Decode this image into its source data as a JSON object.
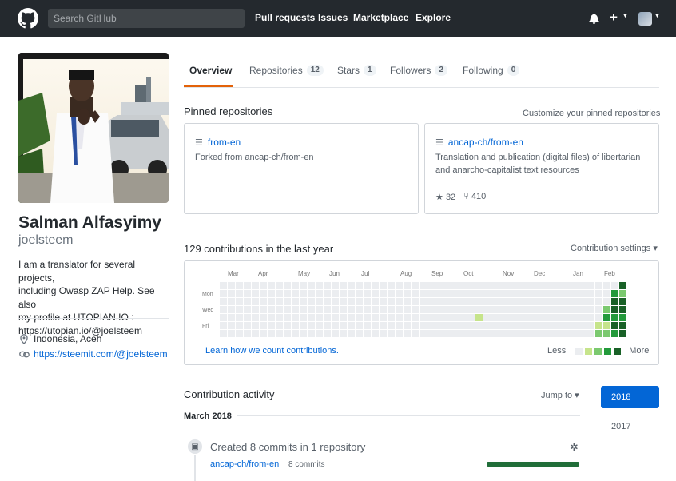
{
  "header": {
    "search_placeholder": "Search GitHub",
    "nav": [
      "Pull requests",
      "Issues",
      "Marketplace",
      "Explore"
    ],
    "icons": [
      "bell-icon",
      "plus-icon",
      "avatar-menu"
    ]
  },
  "profile": {
    "name": "Salman Alfasyimy",
    "login": "joelsteem",
    "bio_lines": [
      "I am a translator for several projects,",
      "including Owasp ZAP Help. See also",
      "my profile at UTOPIAN.IO :",
      "https://utopian.io/@joelsteem"
    ],
    "location": "Indonesia, Aceh",
    "website": "https://steemit.com/@joelsteem"
  },
  "tabs": [
    {
      "label": "Overview",
      "count": ""
    },
    {
      "label": "Repositories",
      "count": "12"
    },
    {
      "label": "Stars",
      "count": "1"
    },
    {
      "label": "Followers",
      "count": "2"
    },
    {
      "label": "Following",
      "count": "0"
    }
  ],
  "pinned": {
    "title": "Pinned repositories",
    "customize": "Customize your pinned repositories",
    "repos": [
      {
        "name": "from-en",
        "desc_lines": [
          "Forked from ancap-ch/from-en"
        ],
        "stars": "",
        "forks": ""
      },
      {
        "name": "ancap-ch/from-en",
        "desc_lines": [
          "Translation and publication (digital files) of libertarian",
          "and anarcho-capitalist text resources"
        ],
        "stars": "32",
        "forks": "410"
      }
    ]
  },
  "contributions": {
    "title": "129 contributions in the last year",
    "settings": "Contribution settings ▾",
    "months": [
      "Mar",
      "Apr",
      "May",
      "Jun",
      "Jul",
      "Aug",
      "Sep",
      "Oct",
      "Nov",
      "Dec",
      "Jan",
      "Feb"
    ],
    "day_labels": [
      "Mon",
      "Wed",
      "Fri"
    ],
    "learn": "Learn how we count contributions.",
    "less": "Less",
    "more": "More",
    "colors": [
      "#ebedf0",
      "#c6e48b",
      "#7bc96f",
      "#239a3b",
      "#196127"
    ]
  },
  "activity": {
    "title": "Contribution activity",
    "jump": "Jump to ▾",
    "years": [
      "2018",
      "2017"
    ],
    "month": "March 2018",
    "summary": "Created 8 commits in 1 repository",
    "repo": "ancap-ch/from-en",
    "commits": "8 commits"
  }
}
